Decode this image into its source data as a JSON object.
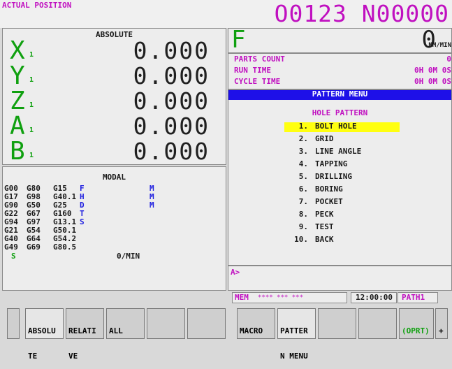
{
  "header": {
    "screen_title": "ACTUAL POSITION",
    "program_number": "O0123 N00000"
  },
  "position": {
    "coord_label": "ABSOLUTE",
    "axes": [
      {
        "name": "X",
        "sub": "1",
        "value": "0.000"
      },
      {
        "name": "Y",
        "sub": "1",
        "value": "0.000"
      },
      {
        "name": "Z",
        "sub": "1",
        "value": "0.000"
      },
      {
        "name": "A",
        "sub": "1",
        "value": "0.000"
      },
      {
        "name": "B",
        "sub": "1",
        "value": "0.000"
      }
    ]
  },
  "modal": {
    "label": "MODAL",
    "rows": [
      [
        "G00",
        "G80",
        "G15",
        "F",
        "M"
      ],
      [
        "G17",
        "G98",
        "G40.1",
        "H",
        "M"
      ],
      [
        "G90",
        "G50",
        "G25",
        "D",
        "M"
      ],
      [
        "G22",
        "G67",
        "G160",
        "T",
        ""
      ],
      [
        "G94",
        "G97",
        "G13.1",
        "S",
        ""
      ],
      [
        "G21",
        "G54",
        "G50.1",
        "",
        ""
      ],
      [
        "G40",
        "G64",
        "G54.2",
        "",
        ""
      ],
      [
        "G49",
        "G69",
        "G80.5",
        "",
        ""
      ]
    ],
    "spindle_label": "S",
    "feed_unit": "0/MIN"
  },
  "feed": {
    "letter": "F",
    "value": "0",
    "unit": "MM/MIN"
  },
  "info": {
    "parts_count_label": "PARTS COUNT",
    "parts_count_value": "0",
    "run_time_label": "RUN TIME",
    "run_time_value": "0H 0M 0S",
    "cycle_time_label": "CYCLE TIME",
    "cycle_time_value": "0H 0M 0S"
  },
  "pattern_menu": {
    "title": "PATTERN MENU",
    "subtitle": "HOLE PATTERN",
    "items": [
      {
        "num": "1.",
        "label": "BOLT HOLE",
        "selected": true
      },
      {
        "num": "2.",
        "label": "GRID"
      },
      {
        "num": "3.",
        "label": "LINE ANGLE"
      },
      {
        "num": "4.",
        "label": "TAPPING"
      },
      {
        "num": "5.",
        "label": "DRILLING"
      },
      {
        "num": "6.",
        "label": "BORING"
      },
      {
        "num": "7.",
        "label": "POCKET"
      },
      {
        "num": "8.",
        "label": "PECK"
      },
      {
        "num": "9.",
        "label": "TEST"
      },
      {
        "num": "10.",
        "label": "BACK"
      }
    ]
  },
  "input": {
    "prompt": "A>"
  },
  "status": {
    "mode": "MEM",
    "dots": "**** *** ***",
    "clock": "12:00:00",
    "path": "PATH1"
  },
  "softkeys": {
    "left": [
      {
        "line1": "ABSOLU",
        "line2": "TE"
      },
      {
        "line1": "RELATI",
        "line2": "VE"
      },
      {
        "line1": "ALL",
        "line2": ""
      },
      {
        "line1": "",
        "line2": ""
      },
      {
        "line1": "",
        "line2": ""
      }
    ],
    "right": [
      {
        "line1": "MACRO",
        "line2": ""
      },
      {
        "line1": "PATTER",
        "line2": "N MENU"
      },
      {
        "line1": "",
        "line2": ""
      },
      {
        "line1": "",
        "line2": ""
      },
      {
        "line1": "(OPRT)",
        "line2": ""
      }
    ],
    "plus": "+"
  },
  "colors": {
    "title_magenta": "#c010c0",
    "axis_green": "#10a010",
    "menu_title_bg": "#1e10e8",
    "selection_yellow": "#ffff10"
  }
}
